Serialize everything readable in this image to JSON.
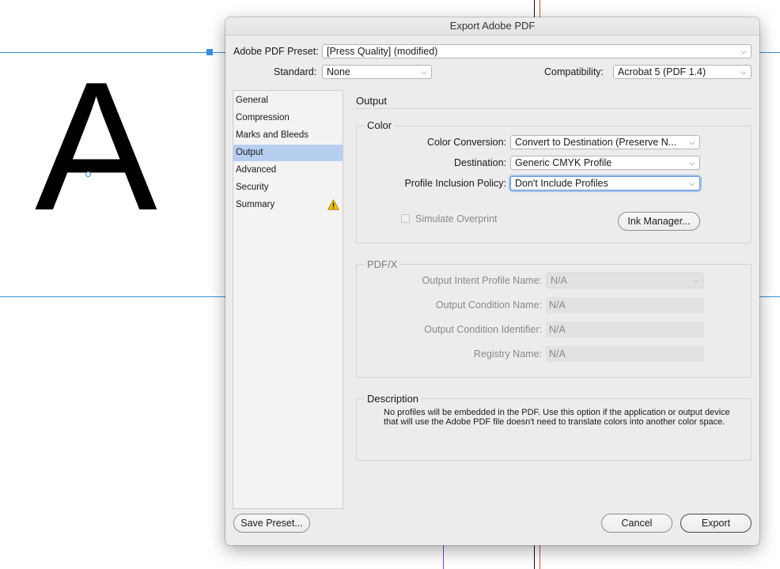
{
  "canvas": {
    "letter": "A"
  },
  "dialog": {
    "title": "Export Adobe PDF",
    "preset_label": "Adobe PDF Preset:",
    "preset_value": "[Press Quality] (modified)",
    "standard_label": "Standard:",
    "standard_value": "None",
    "compatibility_label": "Compatibility:",
    "compatibility_value": "Acrobat 5 (PDF 1.4)"
  },
  "sidebar": {
    "items": [
      {
        "label": "General"
      },
      {
        "label": "Compression"
      },
      {
        "label": "Marks and Bleeds"
      },
      {
        "label": "Output",
        "selected": true
      },
      {
        "label": "Advanced"
      },
      {
        "label": "Security"
      },
      {
        "label": "Summary",
        "icon": "warning-icon"
      }
    ]
  },
  "output": {
    "section_title": "Output",
    "color": {
      "legend": "Color",
      "conversion_label": "Color Conversion:",
      "conversion_value": "Convert to Destination (Preserve N...",
      "destination_label": "Destination:",
      "destination_value": "Generic CMYK Profile",
      "policy_label": "Profile Inclusion Policy:",
      "policy_value": "Don't Include Profiles",
      "simulate_label": "Simulate Overprint",
      "ink_manager_label": "Ink Manager..."
    },
    "pdfx": {
      "legend": "PDF/X",
      "intent_label": "Output Intent Profile Name:",
      "intent_value": "N/A",
      "condition_name_label": "Output Condition Name:",
      "condition_name_value": "N/A",
      "condition_id_label": "Output Condition Identifier:",
      "condition_id_value": "N/A",
      "registry_label": "Registry Name:",
      "registry_value": "N/A"
    },
    "description": {
      "legend": "Description",
      "text_line1": "No profiles will be embedded in the PDF. Use this option if the application or output device",
      "text_line2": "that will use the Adobe PDF file doesn't need to translate colors into another color space."
    }
  },
  "footer": {
    "save_preset_label": "Save Preset...",
    "cancel_label": "Cancel",
    "export_label": "Export"
  },
  "colors": {
    "guide": "#3b8ed8",
    "selection": "#b6cff0",
    "warning": "#f2c200"
  }
}
